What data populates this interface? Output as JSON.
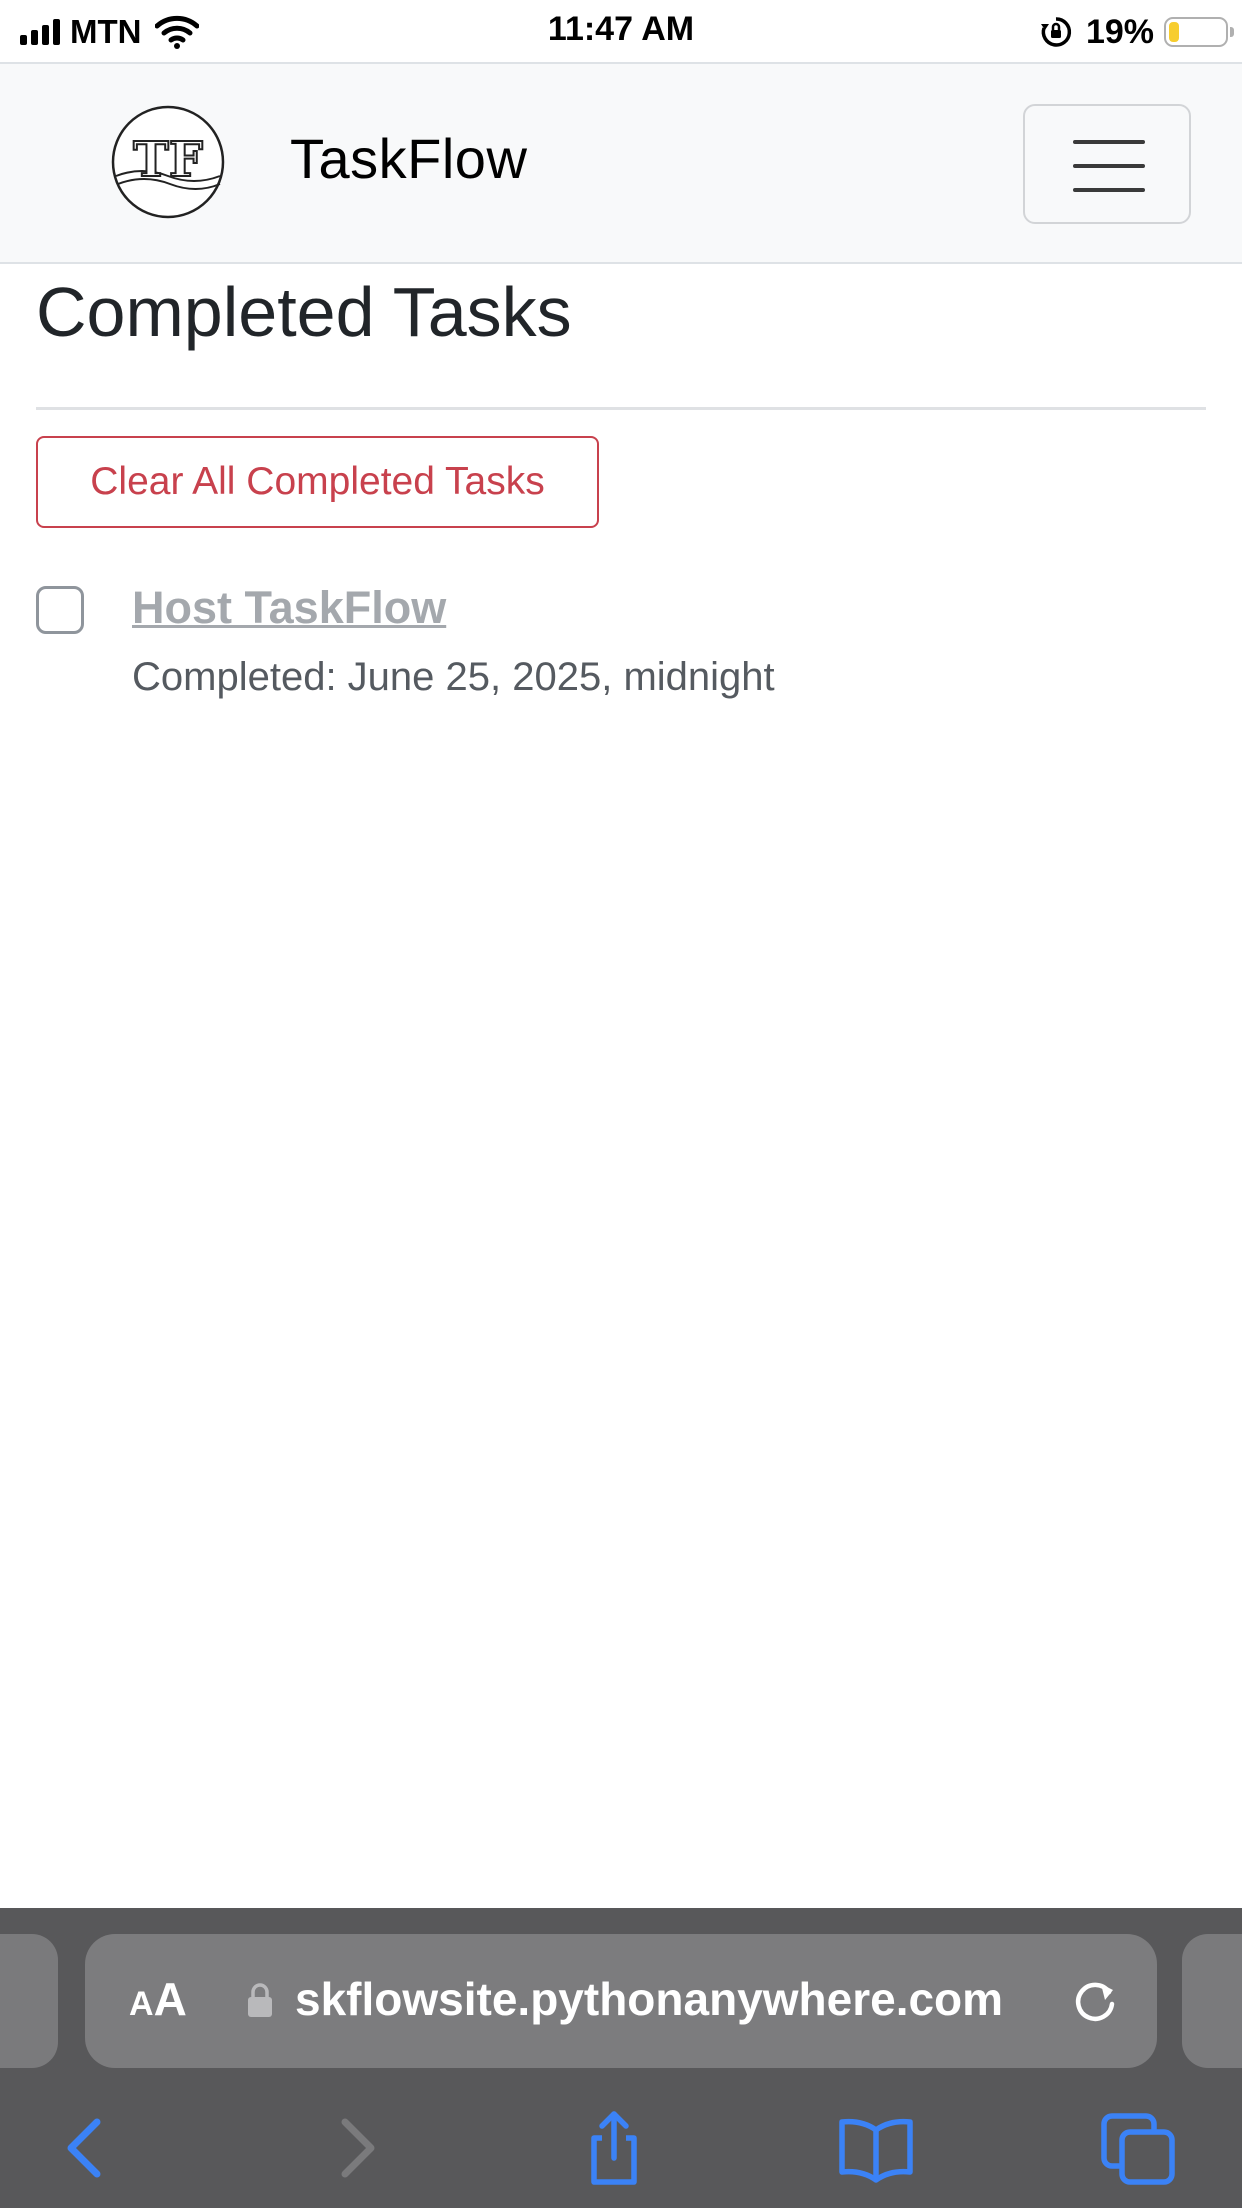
{
  "status_bar": {
    "carrier": "MTN",
    "time": "11:47 AM",
    "battery_percent": "19%",
    "battery_level": 0.19,
    "icons": [
      "signal-icon",
      "wifi-icon",
      "orientation-lock-icon",
      "battery-icon"
    ]
  },
  "navbar": {
    "brand": "TaskFlow",
    "logo_text": "TF",
    "menu_icon": "hamburger-icon"
  },
  "main": {
    "title": "Completed Tasks",
    "clear_button_label": "Clear All Completed Tasks",
    "tasks": [
      {
        "title": "Host TaskFlow",
        "completed_text": "Completed: June 25, 2025, midnight",
        "checked": false
      }
    ]
  },
  "browser": {
    "text_size_small": "A",
    "text_size_big": "A",
    "url": "skflowsite.pythonanywhere.com",
    "icons": [
      "lock-icon",
      "reload-icon",
      "back-icon",
      "forward-icon",
      "share-icon",
      "bookmarks-icon",
      "tabs-icon"
    ]
  },
  "colors": {
    "danger": "#c8414d",
    "navbar_bg": "#f8f9fa",
    "safari_accent": "#3b82f6",
    "safari_bar": "#58585a"
  }
}
